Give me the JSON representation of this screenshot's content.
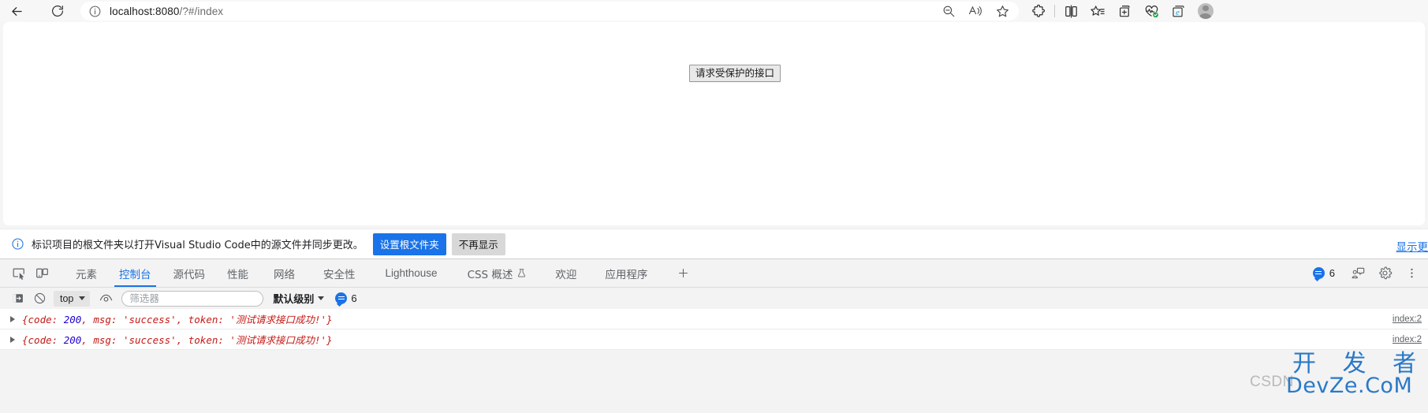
{
  "browser": {
    "back_label": "back-navigation",
    "reload_label": "reload-page",
    "url_display": "localhost:8080/?#/index",
    "url_host": "localhost:8080",
    "url_path": "/?#/index",
    "omnibox_icons": [
      "info-icon"
    ],
    "omnibox_actions": [
      "zoom-out-icon",
      "read-aloud-icon",
      "favorite-star-icon"
    ],
    "toolbar_icons": [
      "extensions-puzzle-icon",
      "split-screen-icon",
      "collections-icon",
      "add-to-collection-icon",
      "browser-essentials-icon",
      "ie-mode-icon",
      "profile-avatar"
    ]
  },
  "page": {
    "button_label": "请求受保护的接口"
  },
  "infobar": {
    "icon": "info-circle-icon",
    "message": "标识项目的根文件夹以打开Visual Studio Code中的源文件并同步更改。",
    "primary_button": "设置根文件夹",
    "secondary_button": "不再显示",
    "more_link": "显示更",
    "accent_color": "#1a73e8"
  },
  "devtools": {
    "left_icons": [
      "inspect-element-icon",
      "device-toolbar-icon"
    ],
    "tabs": [
      {
        "label": "元素",
        "active": false
      },
      {
        "label": "控制台",
        "active": true
      },
      {
        "label": "源代码",
        "active": false
      },
      {
        "label": "性能",
        "active": false
      },
      {
        "label": "网络",
        "active": false
      },
      {
        "label": "安全性",
        "active": false
      },
      {
        "label": "Lighthouse",
        "active": false,
        "latin": true
      },
      {
        "label": "CSS 概述",
        "active": false,
        "badge": "beaker-icon"
      },
      {
        "label": "欢迎",
        "active": false
      },
      {
        "label": "应用程序",
        "active": false
      }
    ],
    "add_tab_label": "+",
    "message_count": "6",
    "right_icons": [
      "feedback-icon",
      "settings-gear-icon",
      "more-options-icon"
    ],
    "active_tab_color": "#1a73e8"
  },
  "console": {
    "toolbar": {
      "sidebar_toggle": "console-sidebar-icon",
      "clear_console": "clear-console-icon",
      "context_value": "top",
      "live_expression": "eye-icon",
      "filter_placeholder": "筛选器",
      "filter_value": "",
      "level_label": "默认级别",
      "message_count": "6"
    },
    "messages": [
      {
        "expandable": true,
        "brace_open": "{",
        "parts": [
          {
            "text": "code: ",
            "type": "key"
          },
          {
            "text": "200",
            "type": "num"
          },
          {
            "text": ", msg: ",
            "type": "key"
          },
          {
            "text": "'success'",
            "type": "str"
          },
          {
            "text": ", token: ",
            "type": "key"
          },
          {
            "text": "'测试请求接口成功!'",
            "type": "str"
          }
        ],
        "brace_close": "}",
        "source": "index:2"
      },
      {
        "expandable": true,
        "brace_open": "{",
        "parts": [
          {
            "text": "code: ",
            "type": "key"
          },
          {
            "text": "200",
            "type": "num"
          },
          {
            "text": ", msg: ",
            "type": "key"
          },
          {
            "text": "'success'",
            "type": "str"
          },
          {
            "text": ", token: ",
            "type": "key"
          },
          {
            "text": "'测试请求接口成功!'",
            "type": "str"
          }
        ],
        "brace_close": "}",
        "source": "index:2"
      }
    ]
  },
  "watermark": {
    "line_cn": "开 发 者",
    "line_en": "DevZe.CoM",
    "csdn": "CSDN",
    "color": "#1a6fc4"
  }
}
